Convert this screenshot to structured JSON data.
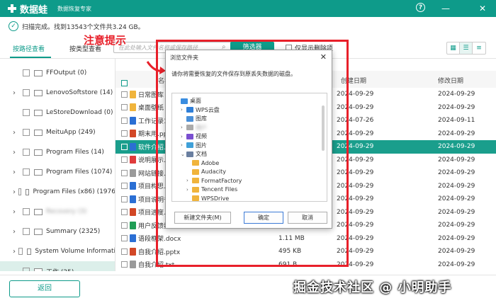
{
  "app": {
    "name": "数据蛙",
    "subtitle": "数据恢复专家",
    "help": "?"
  },
  "window_controls": {
    "minimize": "—",
    "close": "✕"
  },
  "status": {
    "text": "扫描完成。找到13543个文件共3.24 GB。"
  },
  "tabs": [
    {
      "label": "按路径查看",
      "active": true
    },
    {
      "label": "按类型查看",
      "active": false
    }
  ],
  "search": {
    "placeholder": "在此处输入文件名称或保存路径"
  },
  "filter_label": "筛选器",
  "only_deleted_label": "仅显示删除项",
  "annotation": {
    "text": "注意提示"
  },
  "sidebar": {
    "items": [
      {
        "label": "FFOutput (0)",
        "arrow": ""
      },
      {
        "label": "LenovoSoftstore (14)",
        "arrow": "›"
      },
      {
        "label": "LeStoreDownload (0)",
        "arrow": ""
      },
      {
        "label": "MeituApp (249)",
        "arrow": "›"
      },
      {
        "label": "Program Files (14)",
        "arrow": "›"
      },
      {
        "label": "Program Files (1074)",
        "arrow": "›"
      },
      {
        "label": "Program Files (x86) (1976",
        "arrow": "›"
      },
      {
        "label": "Recovery (3)",
        "arrow": "›",
        "blurred": true
      },
      {
        "label": "Summary (2325)",
        "arrow": "›"
      },
      {
        "label": "System Volume Informati",
        "arrow": "›"
      },
      {
        "label": "工作 (25)",
        "arrow": "⌄",
        "selected": true
      }
    ]
  },
  "table": {
    "headers": {
      "name": "名称",
      "size": "大小",
      "created": "创建日期",
      "modified": "修改日期"
    },
    "rows": [
      {
        "name": "日常图库",
        "size": "",
        "created": "2024-09-29",
        "modified": "2024-09-29",
        "icon": "folder"
      },
      {
        "name": "桌面壁纸",
        "size": "",
        "created": "2024-09-29",
        "modified": "2024-09-29",
        "icon": "folder"
      },
      {
        "name": "工作记录1.docx",
        "size": "",
        "created": "2024-07-26",
        "modified": "2024-09-11",
        "icon": "word"
      },
      {
        "name": "期末用.pptx",
        "size": "",
        "created": "2024-09-29",
        "modified": "2024-09-29",
        "icon": "ppt"
      },
      {
        "name": "软件介绍.docx",
        "size": "",
        "created": "2024-09-29",
        "modified": "2024-09-29",
        "icon": "word",
        "selected": true
      },
      {
        "name": "说明展示.pdf",
        "size": "",
        "created": "2024-09-29",
        "modified": "2024-09-29",
        "icon": "pdf"
      },
      {
        "name": "网站链接.txt",
        "size": "",
        "created": "2024-09-29",
        "modified": "2024-09-29",
        "icon": "txt"
      },
      {
        "name": "项目构思.docx",
        "size": "",
        "created": "2024-09-29",
        "modified": "2024-09-29",
        "icon": "word"
      },
      {
        "name": "项目说明书.docx",
        "size": "",
        "created": "2024-09-29",
        "modified": "2024-09-29",
        "icon": "word"
      },
      {
        "name": "项目进度.pptx",
        "size": "",
        "created": "2024-09-29",
        "modified": "2024-09-29",
        "icon": "ppt"
      },
      {
        "name": "用户反馈数据.xlsx",
        "size": "",
        "created": "2024-09-29",
        "modified": "2024-09-29",
        "icon": "excel"
      },
      {
        "name": "语段框架.docx",
        "size": "1.11 MB",
        "created": "2024-09-29",
        "modified": "2024-09-29",
        "icon": "word"
      },
      {
        "name": "自我介绍.pptx",
        "size": "495 KB",
        "created": "2024-09-29",
        "modified": "2024-09-29",
        "icon": "ppt"
      },
      {
        "name": "自我介绍.txt",
        "size": "691 B",
        "created": "2024-09-29",
        "modified": "2024-09-29",
        "icon": "txt"
      }
    ]
  },
  "dialog": {
    "title": "浏览文件夹",
    "close": "✕",
    "message": "请你将需要恢复的文件保存到原丢失数据的磁盘。",
    "tree": [
      {
        "label": "桌面",
        "level": 0,
        "arrow": "",
        "icon": "desktop"
      },
      {
        "label": "WPS云盘",
        "level": 1,
        "arrow": "›",
        "icon": "cloud"
      },
      {
        "label": "图库",
        "level": 1,
        "arrow": "",
        "icon": "gallery"
      },
      {
        "label": "用户",
        "level": 1,
        "arrow": "›",
        "icon": "user",
        "blurred": true
      },
      {
        "label": "视频",
        "level": 1,
        "arrow": "›",
        "icon": "video"
      },
      {
        "label": "图片",
        "level": 1,
        "arrow": "›",
        "icon": "picture"
      },
      {
        "label": "文档",
        "level": 1,
        "arrow": "⌄",
        "icon": "docs"
      },
      {
        "label": "Adobe",
        "level": 2,
        "arrow": "",
        "icon": "folder"
      },
      {
        "label": "Audacity",
        "level": 2,
        "arrow": "",
        "icon": "folder"
      },
      {
        "label": "FormatFactory",
        "level": 2,
        "arrow": "›",
        "icon": "folder"
      },
      {
        "label": "Tencent Files",
        "level": 2,
        "arrow": "›",
        "icon": "folder"
      },
      {
        "label": "WPSDrive",
        "level": 2,
        "arrow": "",
        "icon": "folder"
      }
    ],
    "buttons": {
      "new_folder": "新建文件夹(M)",
      "ok": "确定",
      "cancel": "取消"
    }
  },
  "bottom": {
    "back": "返回"
  },
  "watermark": "掘金技术社区 @ 小明助手",
  "colors": {
    "brand": "#0e9b8a",
    "annotation": "#e8202a",
    "selection": "#1a9e8c"
  }
}
